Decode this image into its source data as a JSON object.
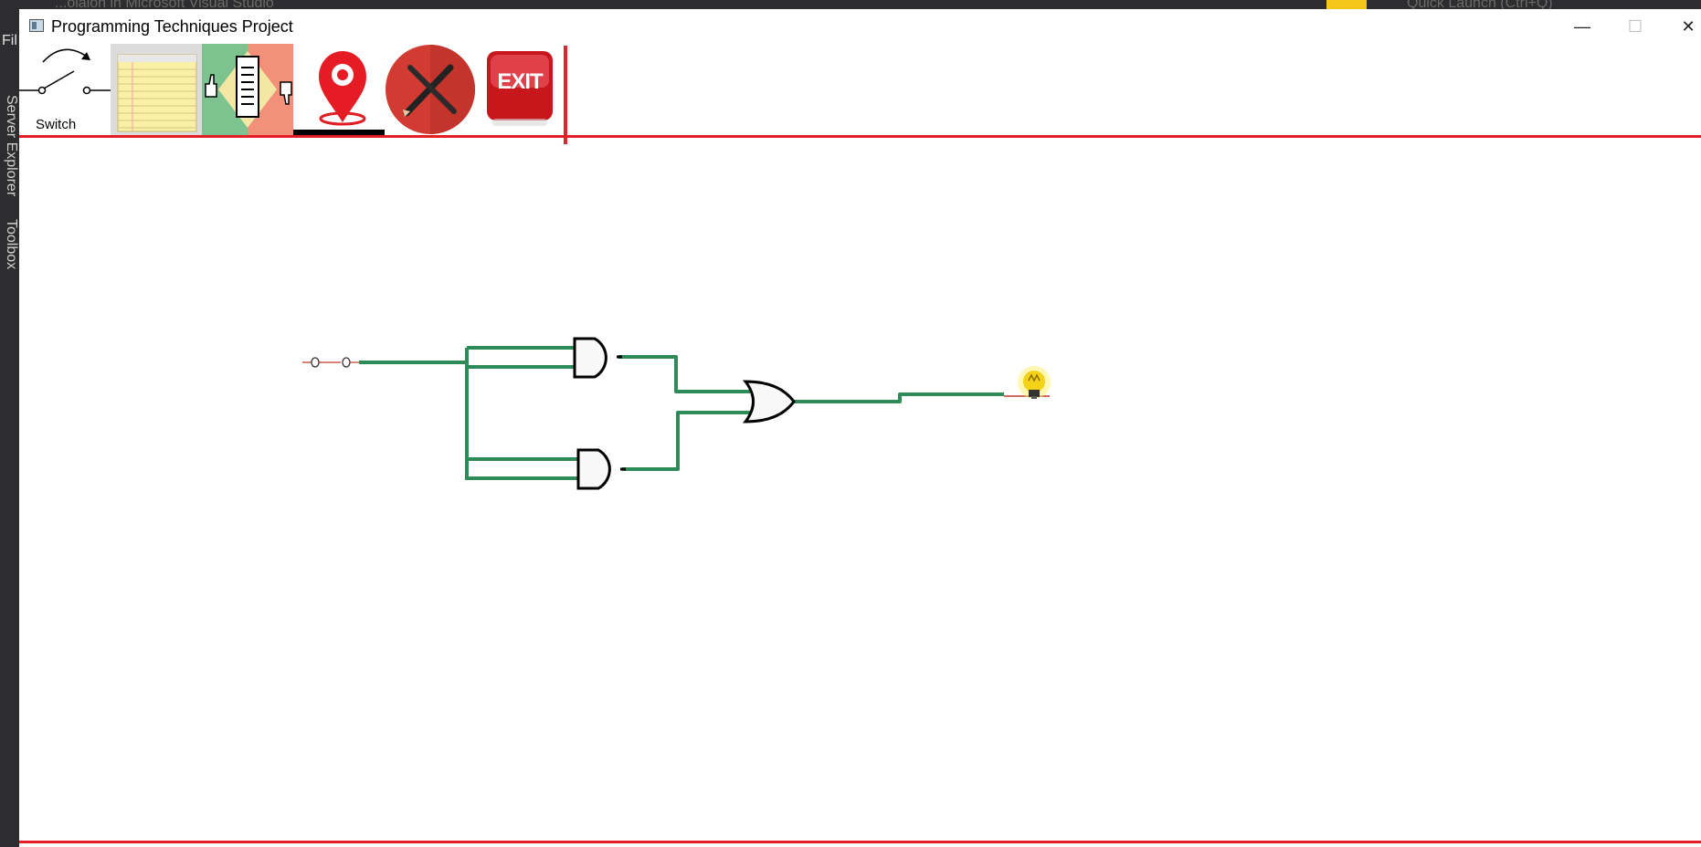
{
  "background_app": {
    "file_menu_label": "Fil",
    "side_tabs": [
      "Server Explorer",
      "Toolbox"
    ],
    "top_ghost_text": "...olaion in Microsoft Visual Studio",
    "quick_launch": "Quick Launch (Ctrl+Q)"
  },
  "window": {
    "title": "Programming Techniques Project",
    "controls": {
      "minimize": "—",
      "maximize": "☐",
      "close": "✕"
    }
  },
  "toolbar": {
    "items": [
      {
        "name": "switch-tool",
        "label": "Switch",
        "icon": "switch-icon"
      },
      {
        "name": "notes-tool",
        "label": "",
        "icon": "notepad-icon"
      },
      {
        "name": "truth-table-tool",
        "label": "",
        "icon": "document-thumbs-icon"
      },
      {
        "name": "probe-tool",
        "label": "",
        "icon": "map-pin-icon"
      },
      {
        "name": "edit-tool",
        "label": "",
        "icon": "pencil-cross-icon"
      },
      {
        "name": "exit-tool",
        "label": "EXIT",
        "icon": "exit-icon"
      }
    ]
  },
  "circuit": {
    "components": [
      {
        "type": "switch",
        "name": "input-switch"
      },
      {
        "type": "and-gate",
        "name": "and-gate-top"
      },
      {
        "type": "and-gate",
        "name": "and-gate-bottom"
      },
      {
        "type": "or-gate",
        "name": "or-gate"
      },
      {
        "type": "led-bulb",
        "name": "output-led",
        "state": "on"
      }
    ],
    "colors": {
      "wire": "#2e8b57",
      "accent": "#e41e25",
      "gate_stroke": "#000000",
      "bulb": "#f5d21a"
    }
  }
}
